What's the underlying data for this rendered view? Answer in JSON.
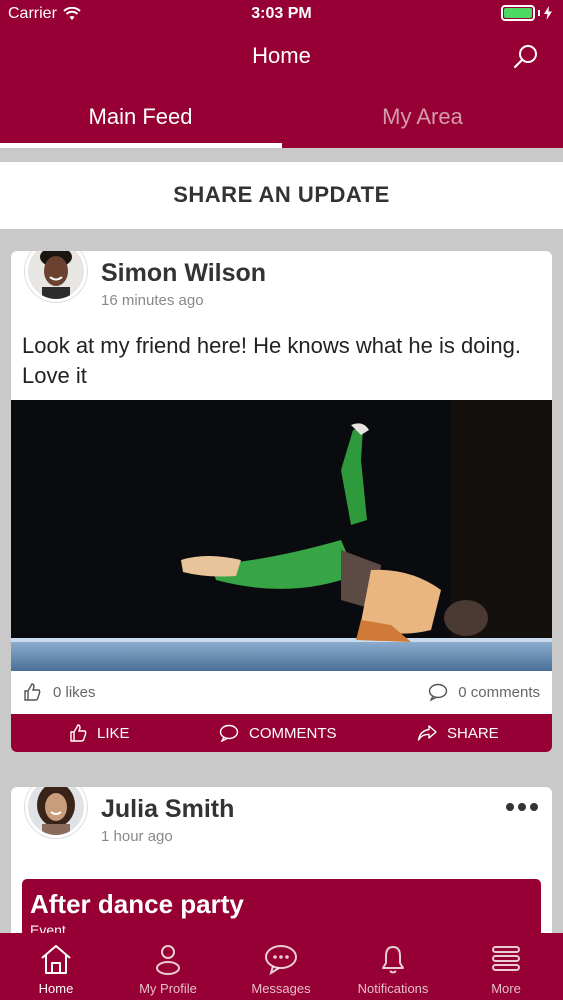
{
  "status_bar": {
    "carrier": "Carrier",
    "time": "3:03 PM"
  },
  "nav": {
    "title": "Home",
    "search_icon": "search-icon"
  },
  "tabs": [
    {
      "label": "Main Feed",
      "active": true
    },
    {
      "label": "My Area",
      "active": false
    }
  ],
  "share": {
    "label": "SHARE AN UPDATE"
  },
  "posts": [
    {
      "author": "Simon Wilson",
      "time": "16 minutes ago",
      "text": "Look at my friend here! He knows what he is doing. Love it",
      "likes": "0 likes",
      "comments": "0 comments",
      "actions": {
        "like": "LIKE",
        "comments": "COMMENTS",
        "share": "SHARE"
      }
    },
    {
      "author": "Julia Smith",
      "time": "1 hour ago",
      "event_title": "After dance party",
      "event_type": "Event"
    }
  ],
  "tabbar": [
    {
      "label": "Home",
      "icon": "home-icon",
      "active": true
    },
    {
      "label": "My Profile",
      "icon": "profile-icon",
      "active": false
    },
    {
      "label": "Messages",
      "icon": "messages-icon",
      "active": false
    },
    {
      "label": "Notifications",
      "icon": "bell-icon",
      "active": false
    },
    {
      "label": "More",
      "icon": "menu-icon",
      "active": false
    }
  ],
  "colors": {
    "primary": "#960034",
    "background": "#c9c9c9"
  }
}
